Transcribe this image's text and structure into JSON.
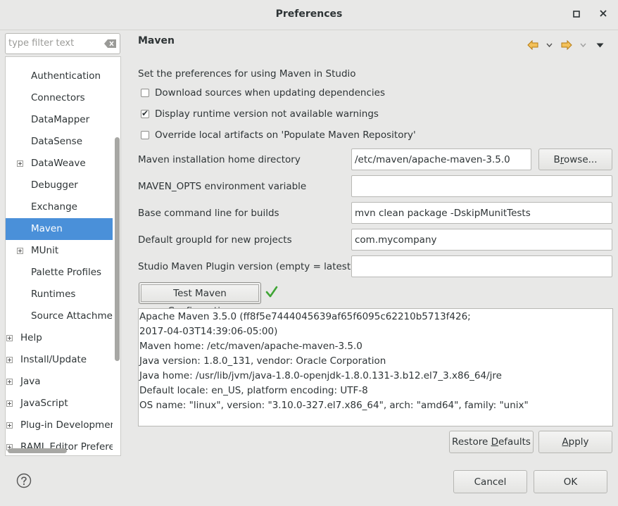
{
  "window": {
    "title": "Preferences"
  },
  "filter": {
    "placeholder": "type filter text"
  },
  "tree": {
    "items": [
      {
        "label": "Authentication",
        "level": 1
      },
      {
        "label": "Connectors",
        "level": 1
      },
      {
        "label": "DataMapper",
        "level": 1
      },
      {
        "label": "DataSense",
        "level": 1
      },
      {
        "label": "DataWeave",
        "level": 1,
        "expandable": true
      },
      {
        "label": "Debugger",
        "level": 1
      },
      {
        "label": "Exchange",
        "level": 1
      },
      {
        "label": "Maven",
        "level": 1,
        "selected": true
      },
      {
        "label": "MUnit",
        "level": 1,
        "expandable": true
      },
      {
        "label": "Palette Profiles",
        "level": 1
      },
      {
        "label": "Runtimes",
        "level": 1
      },
      {
        "label": "Source Attachmer",
        "level": 1
      },
      {
        "label": "Help",
        "level": 0,
        "expandable": true
      },
      {
        "label": "Install/Update",
        "level": 0,
        "expandable": true
      },
      {
        "label": "Java",
        "level": 0,
        "expandable": true
      },
      {
        "label": "JavaScript",
        "level": 0,
        "expandable": true
      },
      {
        "label": "Plug-in Developmen",
        "level": 0,
        "expandable": true
      },
      {
        "label": "RAML Editor Prefere",
        "level": 0,
        "expandable": true
      }
    ]
  },
  "page": {
    "title": "Maven",
    "description": "Set the preferences for using Maven in Studio"
  },
  "options": {
    "download_sources": {
      "label": "Download sources when updating dependencies",
      "checked": false
    },
    "runtime_warnings": {
      "label": "Display runtime version not available warnings",
      "checked": true
    },
    "override_artifacts": {
      "label": "Override local artifacts on 'Populate Maven Repository'",
      "checked": false
    }
  },
  "fields": {
    "maven_home": {
      "label": "Maven installation home directory",
      "value": "/etc/maven/apache-maven-3.5.0"
    },
    "maven_opts": {
      "label": "MAVEN_OPTS environment variable",
      "value": ""
    },
    "base_command": {
      "label": "Base command line for builds",
      "value": "mvn clean package -DskipMunitTests"
    },
    "group_id": {
      "label": "Default groupId for new projects",
      "value": "com.mycompany"
    },
    "plugin_version": {
      "label": "Studio Maven Plugin version (empty = latest)",
      "value": ""
    }
  },
  "buttons": {
    "browse_pre": "B",
    "browse_ul": "r",
    "browse_post": "owse...",
    "test": "Test Maven Configuration",
    "restore_pre": "Restore ",
    "restore_ul": "D",
    "restore_post": "efaults",
    "apply_ul": "A",
    "apply_post": "pply",
    "cancel": "Cancel",
    "ok": "OK"
  },
  "output_lines": [
    "Apache Maven 3.5.0 (ff8f5e7444045639af65f6095c62210b5713f426;",
    "2017-04-03T14:39:06-05:00)",
    "Maven home: /etc/maven/apache-maven-3.5.0",
    "Java version: 1.8.0_131, vendor: Oracle Corporation",
    "Java home: /usr/lib/jvm/java-1.8.0-openjdk-1.8.0.131-3.b12.el7_3.x86_64/jre",
    "Default locale: en_US, platform encoding: UTF-8",
    "OS name: \"linux\", version: \"3.10.0-327.el7.x86_64\", arch: \"amd64\", family: \"unix\""
  ],
  "colors": {
    "selection": "#4a90d9",
    "success": "#3fa535",
    "nav_arrow": "#e8a23a"
  }
}
